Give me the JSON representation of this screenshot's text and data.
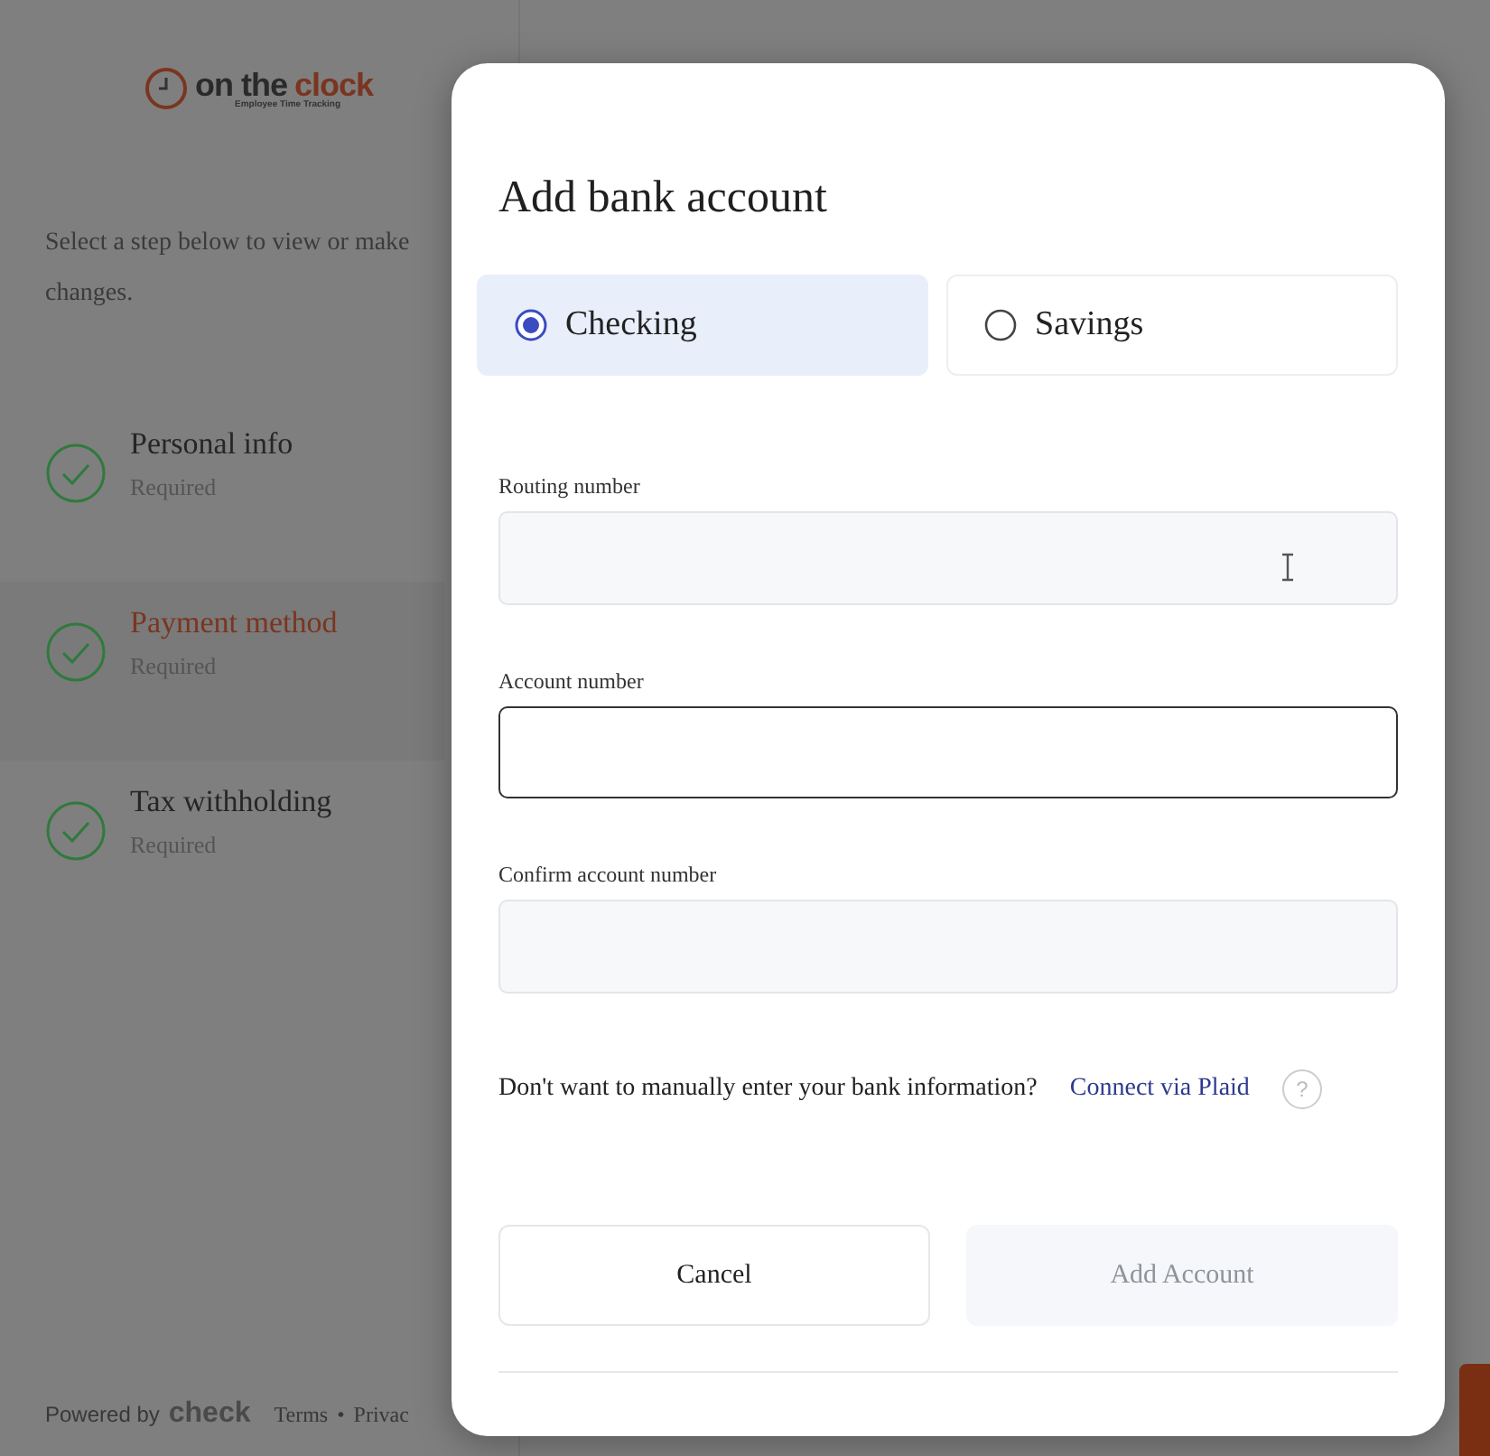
{
  "sidebar": {
    "logo": {
      "prefix": "on the",
      "accent": "clock",
      "tagline": "Employee Time Tracking"
    },
    "intro": "Select a step below to view or make changes.",
    "steps": [
      {
        "title": "Personal info",
        "note": "Required",
        "completed": true,
        "selected": false
      },
      {
        "title": "Payment method",
        "note": "Required",
        "completed": true,
        "selected": true
      },
      {
        "title": "Tax withholding",
        "note": "Required",
        "completed": true,
        "selected": false
      }
    ],
    "footer": {
      "powered": "Powered by",
      "brand": "check",
      "links": [
        "Terms",
        "•",
        "Privac"
      ]
    }
  },
  "dialog": {
    "title": "Add bank account",
    "account_types": [
      {
        "label": "Checking",
        "selected": true
      },
      {
        "label": "Savings",
        "selected": false
      }
    ],
    "fields": [
      {
        "label": "Routing number",
        "focused": false,
        "pointer": true
      },
      {
        "label": "Account number",
        "focused": true
      },
      {
        "label": "Confirm account number",
        "focused": false
      }
    ],
    "plaid": {
      "question": "Don't want to manually enter your bank information?",
      "link": "Connect via Plaid",
      "help": "?"
    },
    "buttons": [
      {
        "label": "Cancel",
        "disabled": false
      },
      {
        "label": "Add Account",
        "disabled": true
      }
    ]
  }
}
